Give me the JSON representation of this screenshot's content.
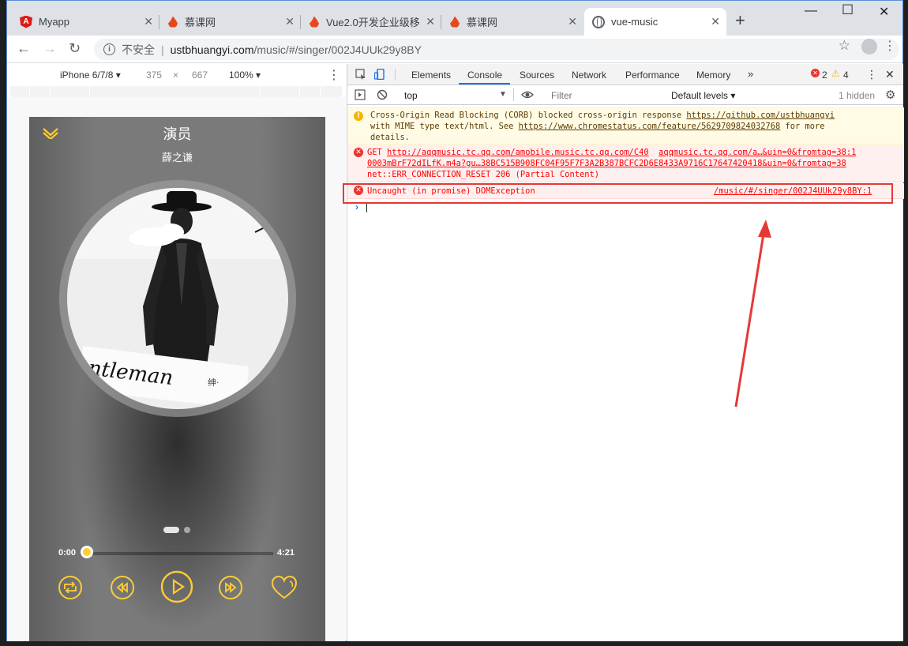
{
  "browser": {
    "tabs": [
      {
        "title": "Myapp",
        "icon": "angular-icon"
      },
      {
        "title": "慕课网",
        "icon": "imooc-icon"
      },
      {
        "title": "Vue2.0开发企业级移动",
        "icon": "imooc-icon"
      },
      {
        "title": "慕课网",
        "icon": "imooc-icon"
      },
      {
        "title": "vue-music",
        "icon": "globe-icon",
        "active": true
      }
    ],
    "address": {
      "security": "不安全",
      "host": "ustbhuangyi.com",
      "path": "/music/#/singer/002J4UUk29y8BY"
    }
  },
  "device_toolbar": {
    "device": "iPhone 6/7/8",
    "width": "375",
    "times": "×",
    "height": "667",
    "zoom": "100%"
  },
  "player": {
    "title": "演员",
    "singer": "薛之谦",
    "current_time": "0:00",
    "total_time": "4:21",
    "progress": 0,
    "accent": "#ffcd32",
    "album_caption": "ntleman",
    "album_caption2": "绅·",
    "controls": [
      "sequence-mode-icon",
      "prev-icon",
      "play-icon",
      "next-icon",
      "favorite-icon"
    ]
  },
  "devtools": {
    "tabs": [
      "Elements",
      "Console",
      "Sources",
      "Network",
      "Performance",
      "Memory",
      "»"
    ],
    "active_tab": "Console",
    "error_count": "2",
    "warning_count": "4",
    "context": "top",
    "filter_placeholder": "Filter",
    "levels": "Default levels",
    "hidden": "1 hidden",
    "messages": {
      "corb": {
        "line1_text": "Cross-Origin Read Blocking (CORB) blocked cross-origin response ",
        "line1_link": "https://github.com/ustbhuangyi",
        "line2_text1": "with MIME type text/html. See ",
        "line2_link": "https://www.chromestatus.com/feature/5629709824032768",
        "line2_text2": " for more",
        "line3": "details."
      },
      "get": {
        "prefix": "GET ",
        "url1": "http://aqqmusic.tc.qq.com/amobile.music.tc.qq.com/C40",
        "url2": "0003mBrF72dILfK.m4a?gu…38BC515B908FC04F95F7F3A2B387BCFC2D6E8433A9716C17647420418&uin=0&fromtag=38",
        "source1": "aqqmusic.tc.qq.com/a…&uin=0&fromtag=38:1",
        "error": "net::ERR_CONNECTION_RESET 206 (Partial Content)"
      },
      "uncaught": {
        "text": "Uncaught (in promise) DOMException",
        "source": "/music/#/singer/002J4UUk29y8BY:1"
      }
    }
  },
  "colors": {
    "annotation": "#e53935",
    "error": "#fe0000",
    "warning_bg": "#fffbe5"
  }
}
